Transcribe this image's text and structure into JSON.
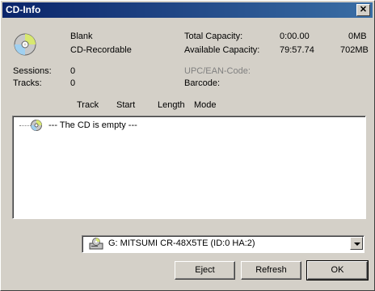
{
  "window": {
    "title": "CD-Info",
    "close_glyph": "✕"
  },
  "disc_info": {
    "status": "Blank",
    "type": "CD-Recordable",
    "total_capacity_label": "Total Capacity:",
    "total_capacity_time": "0:00.00",
    "total_capacity_size": "0MB",
    "available_capacity_label": "Available Capacity:",
    "available_capacity_time": "79:57.74",
    "available_capacity_size": "702MB",
    "sessions_label": "Sessions:",
    "sessions_value": "0",
    "tracks_label": "Tracks:",
    "tracks_value": "0",
    "upc_label": "UPC/EAN-Code:",
    "barcode_label": "Barcode:"
  },
  "track_list": {
    "columns": [
      "Track",
      "Start",
      "Length",
      "Mode"
    ],
    "items": [
      {
        "text": "---   The CD is empty   ---",
        "icon": "cd-icon"
      }
    ]
  },
  "drive_select": {
    "selected": "G: MITSUMI  CR-48X5TE (ID:0  HA:2)",
    "icon": "cd-drive-icon"
  },
  "buttons": {
    "eject": "Eject",
    "refresh": "Refresh",
    "ok": "OK"
  },
  "colors": {
    "titlebar_start": "#0a246a",
    "titlebar_end": "#3a6ea5",
    "face": "#d4d0c8"
  }
}
